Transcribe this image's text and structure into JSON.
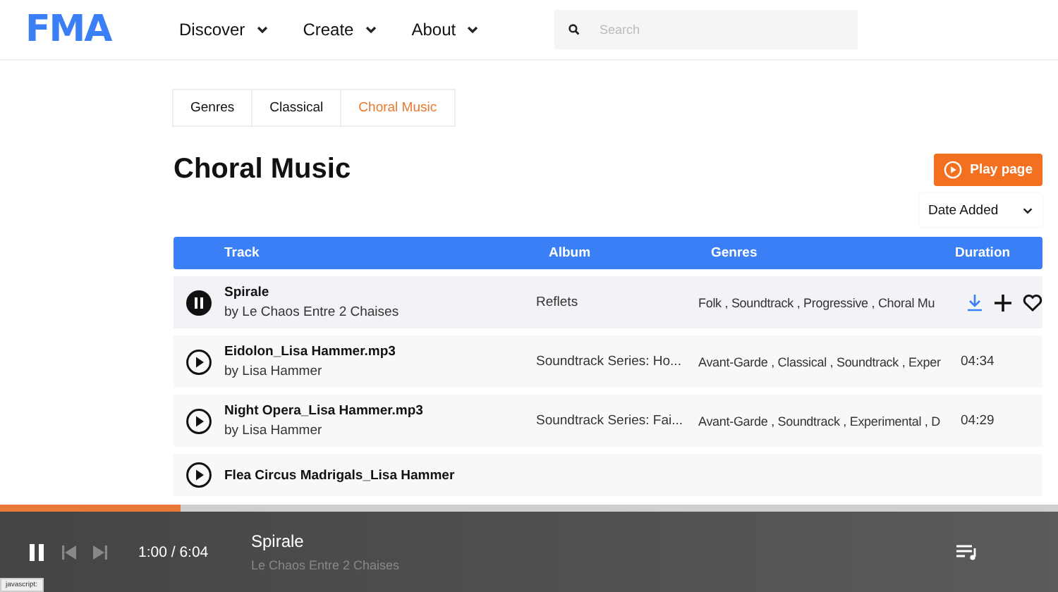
{
  "header": {
    "logo": "FMA",
    "nav": [
      {
        "label": "Discover"
      },
      {
        "label": "Create"
      },
      {
        "label": "About"
      }
    ],
    "search": {
      "placeholder": "Search"
    }
  },
  "breadcrumbs": [
    {
      "label": "Genres",
      "selected": false
    },
    {
      "label": "Classical",
      "selected": false
    },
    {
      "label": "Choral Music",
      "selected": true
    }
  ],
  "title": "Choral Music",
  "play_button": "Play page",
  "sort": {
    "value": "Date Added"
  },
  "table": {
    "columns": [
      "Track",
      "Album",
      "Genres",
      "Duration"
    ],
    "rows": [
      {
        "title": "Spirale",
        "artist": "by Le Chaos Entre 2 Chaises",
        "album": "Reflets",
        "genres": "Folk , Soundtrack , Progressive , Choral Mu",
        "playing": true,
        "hovered": true
      },
      {
        "title": "Eidolon_Lisa Hammer.mp3",
        "artist": "by Lisa Hammer",
        "album": "Soundtrack Series: Ho...",
        "genres": "Avant-Garde , Classical , Soundtrack , Exper",
        "duration": "04:34",
        "playing": false,
        "hovered": false
      },
      {
        "title": "Night Opera_Lisa Hammer.mp3",
        "artist": "by Lisa Hammer",
        "album": "Soundtrack Series: Fai...",
        "genres": "Avant-Garde , Soundtrack , Experimental , D",
        "duration": "04:29",
        "playing": false,
        "hovered": false
      },
      {
        "title": "Flea Circus Madrigals_Lisa Hammer",
        "playing": false,
        "hovered": false
      }
    ]
  },
  "player": {
    "playing": true,
    "level": 0.17,
    "time": "1:00 / 6:04",
    "title": "Spirale",
    "artist": "Le Chaos Entre 2 Chaises"
  },
  "status_tooltip": "javascript:"
}
